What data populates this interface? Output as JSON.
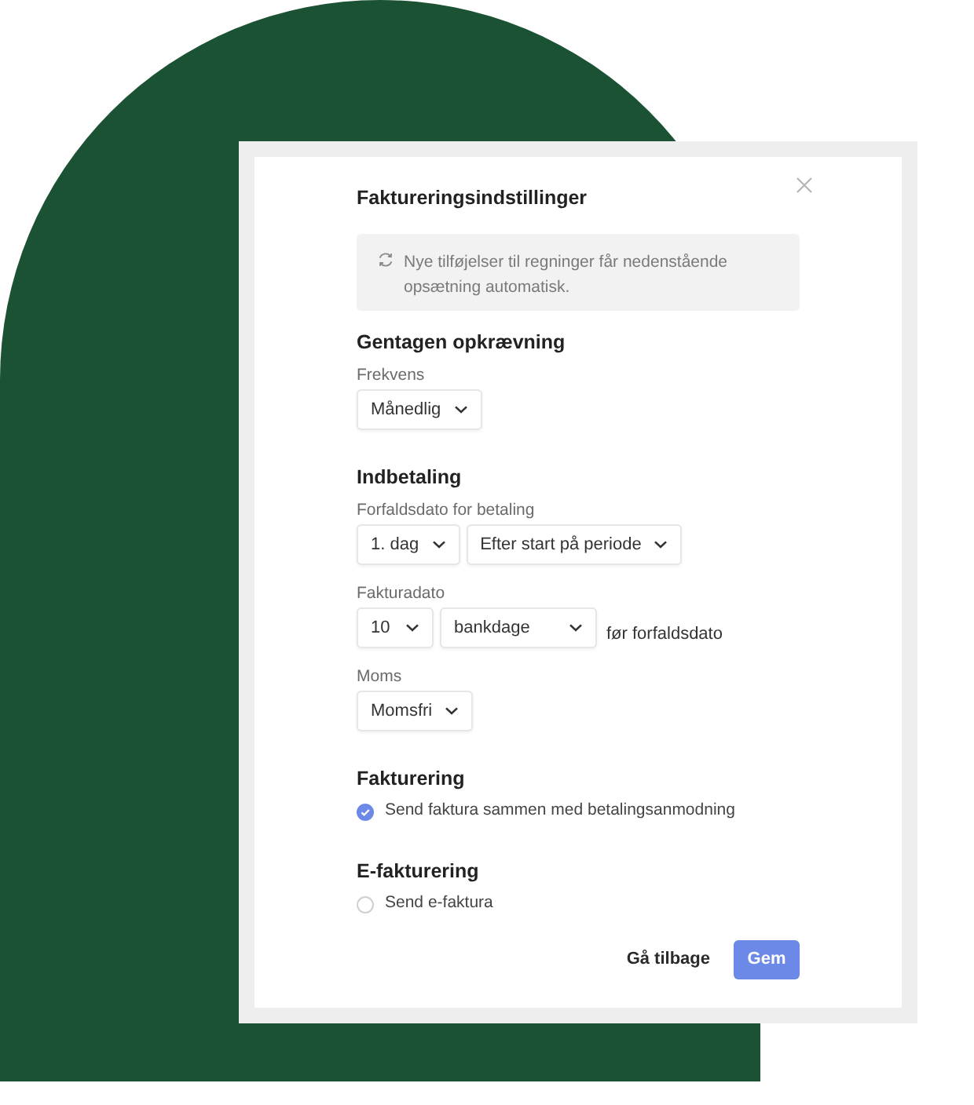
{
  "dialog": {
    "title": "Faktureringsindstillinger"
  },
  "notice": {
    "text": "Nye tilføjelser til regninger får nedenstående opsætning automatisk."
  },
  "sections": [
    {
      "heading": "Gentagen opkrævning",
      "fields": [
        {
          "label": "Frekvens",
          "selects": [
            {
              "value": "Månedlig"
            }
          ]
        }
      ]
    },
    {
      "heading": "Indbetaling",
      "fields": [
        {
          "label": "Forfaldsdato for betaling",
          "selects": [
            {
              "value": "1. dag"
            },
            {
              "value": "Efter start på periode"
            }
          ]
        },
        {
          "label": "Fakturadato",
          "selects": [
            {
              "value": "10"
            },
            {
              "value": "bankdage"
            }
          ],
          "suffix": "før forfaldsdato"
        },
        {
          "label": "Moms",
          "selects": [
            {
              "value": "Momsfri"
            }
          ]
        }
      ]
    },
    {
      "heading": "Fakturering",
      "options": [
        {
          "label": "Send faktura sammen med betalingsanmodning",
          "checked": true
        }
      ]
    },
    {
      "heading": "E-fakturering",
      "options": [
        {
          "label": "Send e-faktura",
          "checked": false
        }
      ]
    }
  ],
  "buttons": [
    {
      "label": "Gå tilbage",
      "kind": "text"
    },
    {
      "label": "Gem",
      "kind": "primary"
    }
  ]
}
